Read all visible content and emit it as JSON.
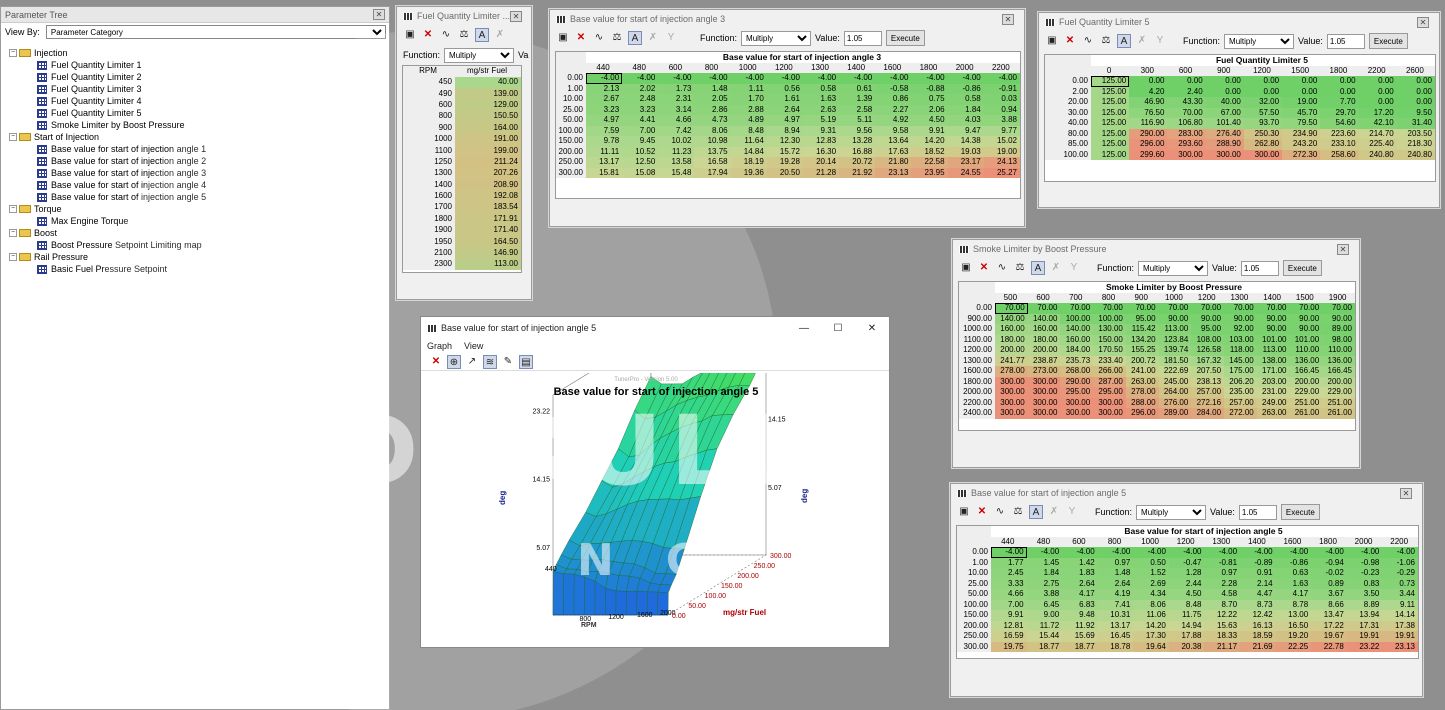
{
  "tree": {
    "title": "Parameter Tree",
    "view_by_label": "View By:",
    "view_by_value": "Parameter Category",
    "groups": [
      {
        "label": "Injection",
        "items": [
          "Fuel Quantity Limiter 1",
          "Fuel Quantity Limiter 2",
          "Fuel Quantity Limiter 3",
          "Fuel Quantity Limiter 4",
          "Fuel Quantity Limiter 5",
          "Smoke Limiter by Boost Pressure"
        ]
      },
      {
        "label": "Start of Injection",
        "items": [
          "Base value for start of injection angle 1",
          "Base value for start of injection angle 2",
          "Base value for start of injection angle 3",
          "Base value for start of injection angle 4",
          "Base value for start of injection angle 5"
        ]
      },
      {
        "label": "Torque",
        "items": [
          "Max Engine Torque"
        ]
      },
      {
        "label": "Boost",
        "items": [
          "Boost Pressure Setpoint Limiting map"
        ]
      },
      {
        "label": "Rail Pressure",
        "items": [
          "Basic Fuel Pressure Setpoint"
        ]
      }
    ]
  },
  "toolbar": {
    "function_label": "Function:",
    "function_value": "Multiply",
    "value_label": "Value:",
    "value": "1.05",
    "execute": "Execute"
  },
  "colors": {
    "green": "#6ed067",
    "lightgreen": "#a9d88c",
    "yellowish": "#cbd694",
    "tan": "#d3c184",
    "salmon": "#eb9079",
    "grey_header": "#eeeeee"
  },
  "watermark": {
    "line1": "OLDSKULL",
    "line2": "TUNING"
  },
  "fql_small": {
    "title": "Fuel Quantity Limiter ...",
    "function_label": "Function:",
    "function_value": "Multiply",
    "value_label": "Va",
    "col1": "RPM",
    "col2": "mg/str Fuel",
    "rpm": [
      "450",
      "490",
      "600",
      "800",
      "900",
      "1000",
      "1100",
      "1250",
      "1300",
      "1400",
      "1600",
      "1700",
      "1800",
      "1900",
      "1950",
      "2100",
      "2300"
    ],
    "values": [
      "40.00",
      "139.00",
      "129.00",
      "150.50",
      "164.00",
      "191.00",
      "199.00",
      "211.24",
      "207.26",
      "208.90",
      "192.08",
      "183.54",
      "171.91",
      "171.40",
      "164.50",
      "146.90",
      "113.00"
    ]
  },
  "soi3": {
    "title": "Base value for start of injection angle 3",
    "map_title": "Base value for start of injection angle 3",
    "cols": [
      "440",
      "480",
      "600",
      "800",
      "1000",
      "1200",
      "1300",
      "1400",
      "1600",
      "1800",
      "2000",
      "2200"
    ],
    "rows": [
      "0.00",
      "1.00",
      "10.00",
      "25.00",
      "50.00",
      "100.00",
      "150.00",
      "200.00",
      "250.00",
      "300.00"
    ],
    "data": [
      [
        "-4.00",
        "-4.00",
        "-4.00",
        "-4.00",
        "-4.00",
        "-4.00",
        "-4.00",
        "-4.00",
        "-4.00",
        "-4.00",
        "-4.00",
        "-4.00"
      ],
      [
        "2.13",
        "2.02",
        "1.73",
        "1.48",
        "1.11",
        "0.56",
        "0.58",
        "0.61",
        "-0.58",
        "-0.88",
        "-0.86",
        "-0.91"
      ],
      [
        "2.67",
        "2.48",
        "2.31",
        "2.05",
        "1.70",
        "1.61",
        "1.63",
        "1.39",
        "0.86",
        "0.75",
        "0.58",
        "0.03"
      ],
      [
        "3.23",
        "3.23",
        "3.14",
        "2.86",
        "2.88",
        "2.64",
        "2.63",
        "2.58",
        "2.27",
        "2.06",
        "1.84",
        "0.94"
      ],
      [
        "4.97",
        "4.41",
        "4.66",
        "4.73",
        "4.89",
        "4.97",
        "5.19",
        "5.11",
        "4.92",
        "4.50",
        "4.03",
        "3.88"
      ],
      [
        "7.59",
        "7.00",
        "7.42",
        "8.06",
        "8.48",
        "8.94",
        "9.31",
        "9.56",
        "9.58",
        "9.91",
        "9.47",
        "9.77"
      ],
      [
        "9.78",
        "9.45",
        "10.02",
        "10.98",
        "11.64",
        "12.30",
        "12.83",
        "13.28",
        "13.64",
        "14.20",
        "14.38",
        "15.02"
      ],
      [
        "11.11",
        "10.52",
        "11.23",
        "13.75",
        "14.84",
        "15.72",
        "16.30",
        "16.88",
        "17.63",
        "18.52",
        "19.03",
        "19.00"
      ],
      [
        "13.17",
        "12.50",
        "13.58",
        "16.58",
        "18.19",
        "19.28",
        "20.14",
        "20.72",
        "21.80",
        "22.58",
        "23.17",
        "24.13"
      ],
      [
        "15.81",
        "15.08",
        "15.48",
        "17.94",
        "19.36",
        "20.50",
        "21.28",
        "21.92",
        "23.13",
        "23.95",
        "24.55",
        "25.27"
      ]
    ]
  },
  "fql5": {
    "title": "Fuel Quantity Limiter 5",
    "map_title": "Fuel Quantity Limiter 5",
    "cols": [
      "0",
      "300",
      "600",
      "900",
      "1200",
      "1500",
      "1800",
      "2200",
      "2600"
    ],
    "rows": [
      "0.00",
      "2.00",
      "20.00",
      "30.00",
      "40.00",
      "80.00",
      "85.00",
      "100.00"
    ],
    "data": [
      [
        "125.00",
        "0.00",
        "0.00",
        "0.00",
        "0.00",
        "0.00",
        "0.00",
        "0.00",
        "0.00"
      ],
      [
        "125.00",
        "4.20",
        "2.40",
        "0.00",
        "0.00",
        "0.00",
        "0.00",
        "0.00",
        "0.00"
      ],
      [
        "125.00",
        "46.90",
        "43.30",
        "40.00",
        "32.00",
        "19.00",
        "7.70",
        "0.00",
        "0.00"
      ],
      [
        "125.00",
        "76.50",
        "70.00",
        "67.00",
        "57.50",
        "45.70",
        "29.70",
        "17.20",
        "9.50"
      ],
      [
        "125.00",
        "116.90",
        "106.80",
        "101.40",
        "93.70",
        "79.50",
        "54.60",
        "42.10",
        "31.40"
      ],
      [
        "125.00",
        "290.00",
        "283.00",
        "276.40",
        "250.30",
        "234.90",
        "223.60",
        "214.70",
        "203.50"
      ],
      [
        "125.00",
        "296.00",
        "293.60",
        "288.90",
        "262.80",
        "243.20",
        "233.10",
        "225.40",
        "218.30"
      ],
      [
        "125.00",
        "299.60",
        "300.00",
        "300.00",
        "300.00",
        "272.30",
        "258.60",
        "240.80",
        "240.80"
      ]
    ]
  },
  "smoke": {
    "title": "Smoke Limiter by Boost Pressure",
    "map_title": "Smoke Limiter by Boost Pressure",
    "cols": [
      "500",
      "600",
      "700",
      "800",
      "900",
      "1000",
      "1200",
      "1300",
      "1400",
      "1500",
      "1900"
    ],
    "rows": [
      "0.00",
      "900.00",
      "1000.00",
      "1100.00",
      "1200.00",
      "1300.00",
      "1600.00",
      "1800.00",
      "2000.00",
      "2200.00",
      "2400.00"
    ],
    "data": [
      [
        "70.00",
        "70.00",
        "70.00",
        "70.00",
        "70.00",
        "70.00",
        "70.00",
        "70.00",
        "70.00",
        "70.00",
        "70.00"
      ],
      [
        "140.00",
        "140.00",
        "100.00",
        "100.00",
        "95.00",
        "90.00",
        "90.00",
        "90.00",
        "90.00",
        "90.00",
        "90.00"
      ],
      [
        "160.00",
        "160.00",
        "140.00",
        "130.00",
        "115.42",
        "113.00",
        "95.00",
        "92.00",
        "90.00",
        "90.00",
        "89.00"
      ],
      [
        "180.00",
        "180.00",
        "160.00",
        "150.00",
        "134.20",
        "123.84",
        "108.00",
        "103.00",
        "101.00",
        "101.00",
        "98.00"
      ],
      [
        "200.00",
        "200.00",
        "184.00",
        "170.50",
        "155.25",
        "139.74",
        "126.58",
        "118.00",
        "113.00",
        "110.00",
        "110.00"
      ],
      [
        "241.77",
        "238.87",
        "235.73",
        "233.40",
        "200.72",
        "181.50",
        "167.32",
        "145.00",
        "138.00",
        "136.00",
        "136.00"
      ],
      [
        "278.00",
        "273.00",
        "268.00",
        "266.00",
        "241.00",
        "222.69",
        "207.50",
        "175.00",
        "171.00",
        "166.45",
        "166.45"
      ],
      [
        "300.00",
        "300.00",
        "290.00",
        "287.00",
        "263.00",
        "245.00",
        "238.13",
        "206.20",
        "203.00",
        "200.00",
        "200.00"
      ],
      [
        "300.00",
        "300.00",
        "295.00",
        "295.00",
        "278.00",
        "264.00",
        "257.00",
        "235.00",
        "231.00",
        "229.00",
        "229.00"
      ],
      [
        "300.00",
        "300.00",
        "300.00",
        "300.00",
        "288.00",
        "276.00",
        "272.16",
        "257.00",
        "249.00",
        "251.00",
        "251.00"
      ],
      [
        "300.00",
        "300.00",
        "300.00",
        "300.00",
        "296.00",
        "289.00",
        "284.00",
        "272.00",
        "263.00",
        "261.00",
        "261.00"
      ]
    ]
  },
  "soi5": {
    "title": "Base value for start of injection angle 5",
    "map_title": "Base value for start of injection angle 5",
    "cols": [
      "440",
      "480",
      "600",
      "800",
      "1000",
      "1200",
      "1300",
      "1400",
      "1600",
      "1800",
      "2000",
      "2200"
    ],
    "rows": [
      "0.00",
      "1.00",
      "10.00",
      "25.00",
      "50.00",
      "100.00",
      "150.00",
      "200.00",
      "250.00",
      "300.00"
    ],
    "data": [
      [
        "-4.00",
        "-4.00",
        "-4.00",
        "-4.00",
        "-4.00",
        "-4.00",
        "-4.00",
        "-4.00",
        "-4.00",
        "-4.00",
        "-4.00",
        "-4.00"
      ],
      [
        "1.77",
        "1.45",
        "1.42",
        "0.97",
        "0.50",
        "-0.47",
        "-0.81",
        "-0.89",
        "-0.86",
        "-0.94",
        "-0.98",
        "-1.06"
      ],
      [
        "2.45",
        "1.84",
        "1.83",
        "1.48",
        "1.52",
        "1.28",
        "0.97",
        "0.91",
        "0.63",
        "-0.02",
        "-0.23",
        "-0.29"
      ],
      [
        "3.33",
        "2.75",
        "2.64",
        "2.64",
        "2.69",
        "2.44",
        "2.28",
        "2.14",
        "1.63",
        "0.89",
        "0.83",
        "0.73"
      ],
      [
        "4.66",
        "3.88",
        "4.17",
        "4.19",
        "4.34",
        "4.50",
        "4.58",
        "4.47",
        "4.17",
        "3.67",
        "3.50",
        "3.44"
      ],
      [
        "7.00",
        "6.45",
        "6.83",
        "7.41",
        "8.06",
        "8.48",
        "8.70",
        "8.73",
        "8.78",
        "8.66",
        "8.89",
        "9.11"
      ],
      [
        "9.91",
        "9.00",
        "9.48",
        "10.31",
        "11.06",
        "11.75",
        "12.22",
        "12.42",
        "13.00",
        "13.47",
        "13.94",
        "14.14"
      ],
      [
        "12.81",
        "11.72",
        "11.92",
        "13.17",
        "14.20",
        "14.94",
        "15.63",
        "16.13",
        "16.50",
        "17.22",
        "17.31",
        "17.38"
      ],
      [
        "16.59",
        "15.44",
        "15.69",
        "16.45",
        "17.30",
        "17.88",
        "18.33",
        "18.59",
        "19.20",
        "19.67",
        "19.91",
        "19.91"
      ],
      [
        "19.75",
        "18.77",
        "18.77",
        "18.78",
        "19.64",
        "20.38",
        "21.17",
        "21.69",
        "22.25",
        "22.78",
        "23.22",
        "23.13"
      ]
    ]
  },
  "graph": {
    "title": "Base value for start of injection angle 5",
    "menu_graph": "Graph",
    "menu_view": "View",
    "watermark": "TunerPro - Version 5.00",
    "plot_title": "Base value for start of injection angle 5",
    "z_ticks": [
      "23.22",
      "14.15",
      "5.07"
    ],
    "z_label": "deg",
    "x_ticks": [
      "440",
      "800",
      "1200",
      "1600",
      "2000"
    ],
    "x_label": "RPM",
    "y_ticks": [
      "0.00",
      "50.00",
      "100.00",
      "150.00",
      "200.00",
      "250.00",
      "300.00"
    ],
    "y_label": "mg/str Fuel"
  }
}
